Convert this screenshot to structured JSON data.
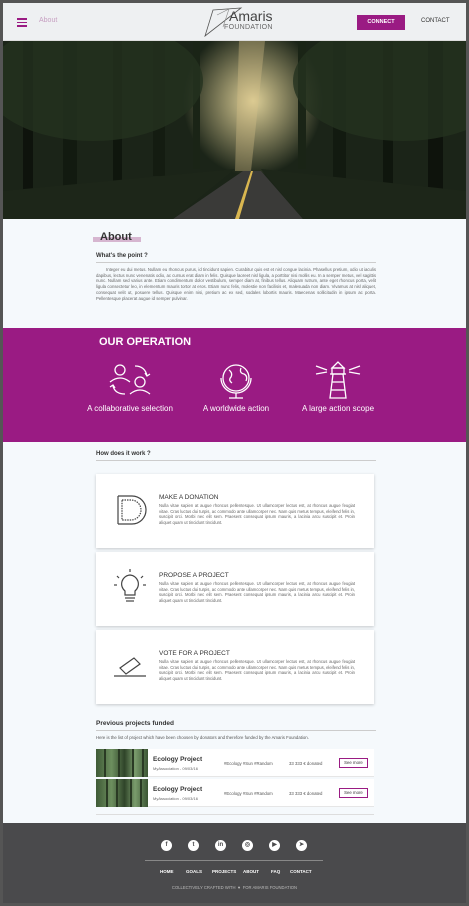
{
  "header": {
    "about_label": "About",
    "logo_title": "Amaris",
    "logo_subtitle": "FOUNDATION",
    "connect_label": "CONNECT",
    "contact_label": "CONTACT"
  },
  "about": {
    "title": "About",
    "subtitle": "What's the point ?",
    "text": "Integer eu dui metus. Nullam eu rhoncus purus, id tincidunt sapien. Curabitur quis est et nisl congue lacinia. Phasellus pretium, odio ut iaculis dapibus, lectus nunc venenatis odio, ac cursus erat diam in felis. Quisque laoreet nisl ligula, a porttitor nisi mollis eu. In a semper metus, vel sagittis nunc. Nullam sed varius ante. Etiam condimentum dolor vestibulum, semper diam at, finibus tellus. Aliquam rutrum, ante eget rhoncus porta, velit ligula consectetur leo, in elementum mauris tortor at eros. Etiam nunc felis, molestie non facilisis et, malesuada non diam. Vivamus at nisl aliquet, consequat velit ut, posuere tellus. Quisque enim nisi, pretium ac ex sed, sodales lobortis mauris. Maecenas sollicitudin in ipsum ac porta. Pellentesque placerat augue id semper pulvinar."
  },
  "operation": {
    "title": "OUR OPERATION",
    "items": [
      {
        "label": "A collaborative selection",
        "icon": "users-exchange-icon"
      },
      {
        "label": "A worldwide action",
        "icon": "globe-icon"
      },
      {
        "label": "A large action scope",
        "icon": "lighthouse-icon"
      }
    ]
  },
  "how": {
    "title": "How does it work ?",
    "steps": [
      {
        "title": "MAKE A DONATION",
        "icon": "coin-icon",
        "text": "Nulla vitae sapien at augue rhoncus pellentesque. Ut ullamcorper lectus est, at rhoncus augue feugiat vitae. Cras luctus dui turpis, ac commodo ante ullamcorper nec. Nam quis metus tempus, eleifend felis in, suscipit orci. Morbi nec elit sem. Praesent consequat ipsum mauris, a lacinia arcu suscipit et. Proin aliquet quam ut tincidunt tincidunt."
      },
      {
        "title": "PROPOSE A PROJECT",
        "icon": "lightbulb-icon",
        "text": "Nulla vitae sapien at augue rhoncus pellentesque. Ut ullamcorper lectus est, at rhoncus augue feugiat vitae. Cras luctus dui turpis, ac commodo ante ullamcorper nec. Nam quis metus tempus, eleifend felis in, suscipit orci. Morbi nec elit sem. Praesent consequat ipsum mauris, a lacinia arcu suscipit et. Proin aliquet quam ut tincidunt tincidunt."
      },
      {
        "title": "VOTE FOR A PROJECT",
        "icon": "ballot-icon",
        "text": "Nulla vitae sapien at augue rhoncus pellentesque. Ut ullamcorper lectus est, at rhoncus augue feugiat vitae. Cras luctus dui turpis, ac commodo ante ullamcorper nec. Nam quis metus tempus, eleifend felis in, suscipit orci. Morbi nec elit sem. Praesent consequat ipsum mauris, a lacinia arcu suscipit et. Proin aliquet quam ut tincidunt tincidunt."
      }
    ]
  },
  "previous": {
    "title": "Previous projects funded",
    "description": "Here is the list of project which have been choosen by donators and therefore funded by the Amaris Foundation.",
    "projects": [
      {
        "name": "Ecology Project",
        "meta": "MyAssociation - 09/03/16",
        "tags": "#Ecology #Sun #Random",
        "amount": "33 333 € donated",
        "button": "See more"
      },
      {
        "name": "Ecology Project",
        "meta": "MyAssociation - 09/03/16",
        "tags": "#Ecology #Sun #Random",
        "amount": "33 333 € donated",
        "button": "See more"
      }
    ]
  },
  "footer": {
    "social": [
      {
        "icon": "facebook-icon",
        "glyph": "f"
      },
      {
        "icon": "twitter-icon",
        "glyph": "t"
      },
      {
        "icon": "linkedin-icon",
        "glyph": "in"
      },
      {
        "icon": "instagram-icon",
        "glyph": "◎"
      },
      {
        "icon": "youtube-icon",
        "glyph": "▶"
      },
      {
        "icon": "telegram-icon",
        "glyph": "➤"
      }
    ],
    "links": [
      "HOME",
      "GOALS",
      "PROJECTS",
      "ABOUT",
      "FAQ",
      "CONTACT"
    ],
    "credit_prefix": "COLLECTIVELY CRAFTED WITH",
    "credit_suffix": "FOR AMARIS FOUNDATION"
  },
  "colors": {
    "accent": "#9a1b83",
    "footer": "#4a4a4c",
    "background": "#f5f9fc"
  }
}
